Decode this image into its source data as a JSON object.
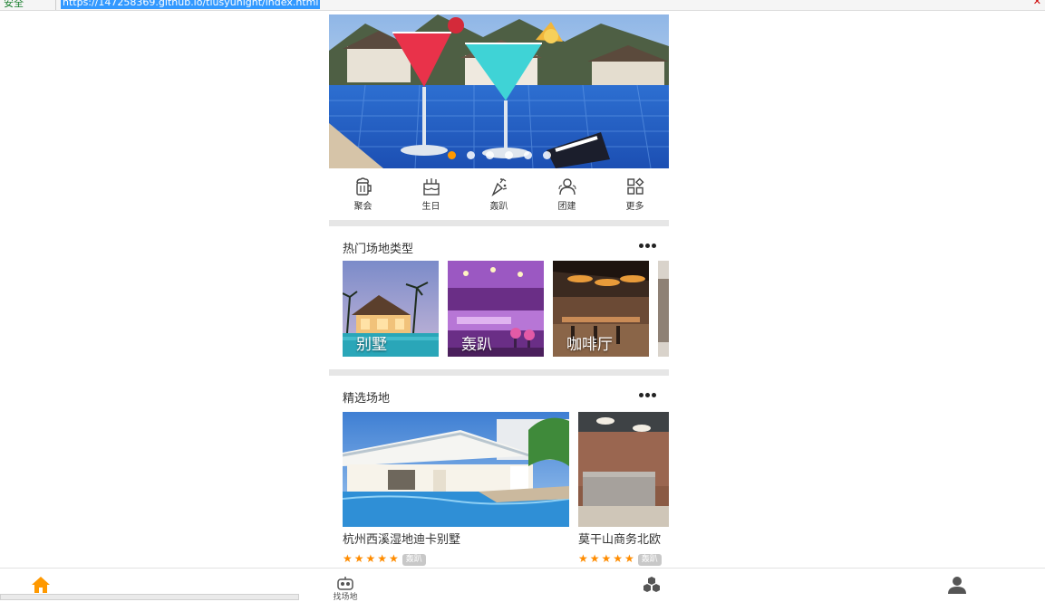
{
  "browser": {
    "security_label": "安全",
    "url": "https://147258369.github.io/tiusyunight/index.html"
  },
  "banner": {
    "slide_count": 6,
    "active_slide": 0
  },
  "categories": [
    {
      "label": "聚会",
      "icon": "beer-mug-icon"
    },
    {
      "label": "生日",
      "icon": "birthday-cake-icon"
    },
    {
      "label": "轰趴",
      "icon": "party-popper-icon"
    },
    {
      "label": "团建",
      "icon": "team-people-icon"
    },
    {
      "label": "更多",
      "icon": "grid-more-icon"
    }
  ],
  "hot_types": {
    "title": "热门场地类型",
    "items": [
      {
        "name": "别墅"
      },
      {
        "name": "轰趴"
      },
      {
        "name": "咖啡厅"
      }
    ]
  },
  "featured": {
    "title": "精选场地",
    "items": [
      {
        "name": "杭州西溪湿地迪卡别墅",
        "stars": "★★★★★",
        "tag": "轰趴"
      },
      {
        "name": "莫干山商务北欧",
        "stars": "★★★★★",
        "tag": "轰趴"
      }
    ]
  },
  "tabbar": {
    "tabs": [
      {
        "icon": "home-icon",
        "label": "",
        "color": "#ff9900"
      },
      {
        "icon": "robot-face-icon",
        "label": "找场地"
      },
      {
        "icon": "cubes-icon",
        "label": ""
      },
      {
        "icon": "user-icon",
        "label": ""
      }
    ]
  },
  "colors": {
    "accent": "#ff9900",
    "divider": "#e6e6e6",
    "star": "#ff8c00"
  }
}
